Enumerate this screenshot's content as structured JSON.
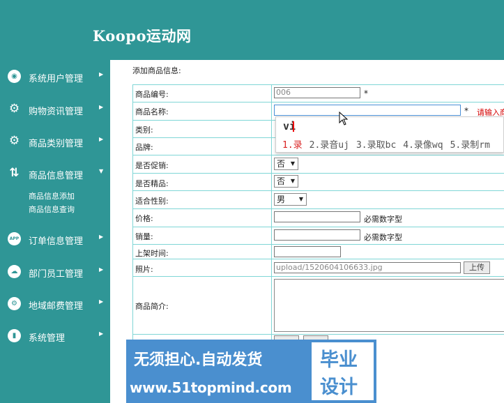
{
  "header": {
    "brand": "Koopo运动网",
    "bg_color": "#2f9696"
  },
  "sidebar": {
    "items": [
      {
        "label": "系统用户管理",
        "icon": "user-circle-icon",
        "glyph": "◉"
      },
      {
        "label": "购物资讯管理",
        "icon": "user-gear-icon",
        "glyph": "⚙"
      },
      {
        "label": "商品类别管理",
        "icon": "user-gear-icon",
        "glyph": "⚙"
      },
      {
        "label": "商品信息管理",
        "icon": "transfer-arrows-icon",
        "glyph": "⇅"
      },
      {
        "label": "订单信息管理",
        "icon": "app-icon",
        "glyph": "APP"
      },
      {
        "label": "部门员工管理",
        "icon": "cloud-icon",
        "glyph": "☁"
      },
      {
        "label": "地域邮费管理",
        "icon": "settings-icon",
        "glyph": "⚙"
      },
      {
        "label": "系统管理",
        "icon": "chart-icon",
        "glyph": "▮"
      }
    ],
    "sub_items": [
      "商品信息添加",
      "商品信息查询"
    ],
    "arrow_collapsed": "▶",
    "arrow_expanded": "▼"
  },
  "form": {
    "title": "添加商品信息:",
    "labels": {
      "code": "商品编号:",
      "name": "商品名称:",
      "category": "类别:",
      "brand": "品牌:",
      "promo": "是否促销:",
      "featured": "是否精品:",
      "gender": "适合性别:",
      "price": "价格:",
      "sales": "销量:",
      "shelf_time": "上架时间:",
      "photo": "照片:",
      "intro": "商品简介:"
    },
    "code_value": "006",
    "required_mark": "*",
    "name_warning": "请输入商",
    "promo_value": "否",
    "featured_value": "否",
    "gender_value": "男",
    "numeric_hint": "必需数字型",
    "photo_value": "upload/1520604106633.jpg",
    "upload_button": "上传"
  },
  "ime": {
    "composition": "vi",
    "candidates": [
      "1.录",
      "2.录音uj",
      "3.录取bc",
      "4.录像wq",
      "5.录制rm"
    ]
  },
  "watermark": {
    "line1": "无须担心.自动发货",
    "line2": "www.51topmind.com",
    "side_top": "毕业",
    "side_bottom": "设计",
    "color": "#4a8fcf"
  }
}
